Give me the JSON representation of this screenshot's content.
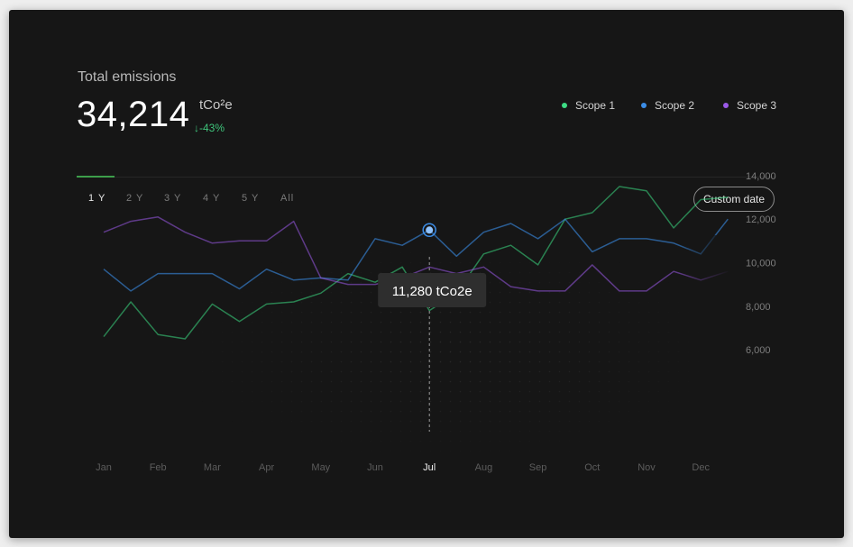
{
  "summary": {
    "title": "Total emissions",
    "value": "34,214",
    "unit": "tCo²e",
    "change": "↓-43%"
  },
  "legend": [
    {
      "label": "Scope 1",
      "color": "#3ddc84"
    },
    {
      "label": "Scope 2",
      "color": "#3b8de8"
    },
    {
      "label": "Scope 3",
      "color": "#9b59e8"
    }
  ],
  "range_tabs": [
    "1 Y",
    "2 Y",
    "3 Y",
    "4 Y",
    "5 Y",
    "All"
  ],
  "active_tab": "1 Y",
  "custom_date_label": "Custom date",
  "tooltip": {
    "text": "11,280 tCo2e",
    "month": "Jul"
  },
  "chart_data": {
    "type": "line",
    "categories": [
      "Jan",
      "Feb",
      "Mar",
      "Apr",
      "May",
      "Jun",
      "Jul",
      "Aug",
      "Sep",
      "Oct",
      "Nov",
      "Dec"
    ],
    "yticks": [
      "6,000",
      "8,000",
      "10,000",
      "12,000",
      "14,000"
    ],
    "ylim": [
      5000,
      15000
    ],
    "highlight": "Jul",
    "series": [
      {
        "name": "Scope 1",
        "color": "#3ddc84",
        "x": [
          0,
          0.5,
          1,
          1.5,
          2,
          2.5,
          3,
          3.5,
          4,
          4.5,
          5,
          5.5,
          6,
          6.5,
          7,
          7.5,
          8,
          8.5,
          9,
          9.5,
          10,
          10.5,
          11,
          11.5
        ],
        "values": [
          6600,
          8200,
          6700,
          6500,
          8100,
          7300,
          8100,
          8200,
          8600,
          9500,
          9100,
          9800,
          7800,
          8600,
          10400,
          10800,
          9900,
          12000,
          12300,
          13500,
          13300,
          11600,
          12900,
          13000
        ]
      },
      {
        "name": "Scope 2",
        "color": "#3b8de8",
        "x": [
          0,
          0.5,
          1,
          1.5,
          2,
          2.5,
          3,
          3.5,
          4,
          4.5,
          5,
          5.5,
          6,
          6.5,
          7,
          7.5,
          8,
          8.5,
          9,
          9.5,
          10,
          10.5,
          11,
          11.5
        ],
        "values": [
          9700,
          8700,
          9500,
          9500,
          9500,
          8800,
          9700,
          9200,
          9300,
          9200,
          11100,
          10800,
          11500,
          10300,
          11400,
          11800,
          11100,
          12000,
          10500,
          11100,
          11100,
          10900,
          10400,
          12000
        ]
      },
      {
        "name": "Scope 3",
        "color": "#9b59e8",
        "x": [
          0,
          0.5,
          1,
          1.5,
          2,
          2.5,
          3,
          3.5,
          4,
          4.5,
          5,
          5.5,
          6,
          6.5,
          7,
          7.5,
          8,
          8.5,
          9,
          9.5,
          10,
          10.5,
          11,
          11.5
        ],
        "values": [
          11400,
          11900,
          12100,
          11400,
          10900,
          11000,
          11000,
          11900,
          9300,
          9000,
          9000,
          9300,
          9800,
          9500,
          9800,
          8900,
          8700,
          8700,
          9900,
          8700,
          8700,
          9600,
          9200,
          9600
        ]
      }
    ]
  }
}
